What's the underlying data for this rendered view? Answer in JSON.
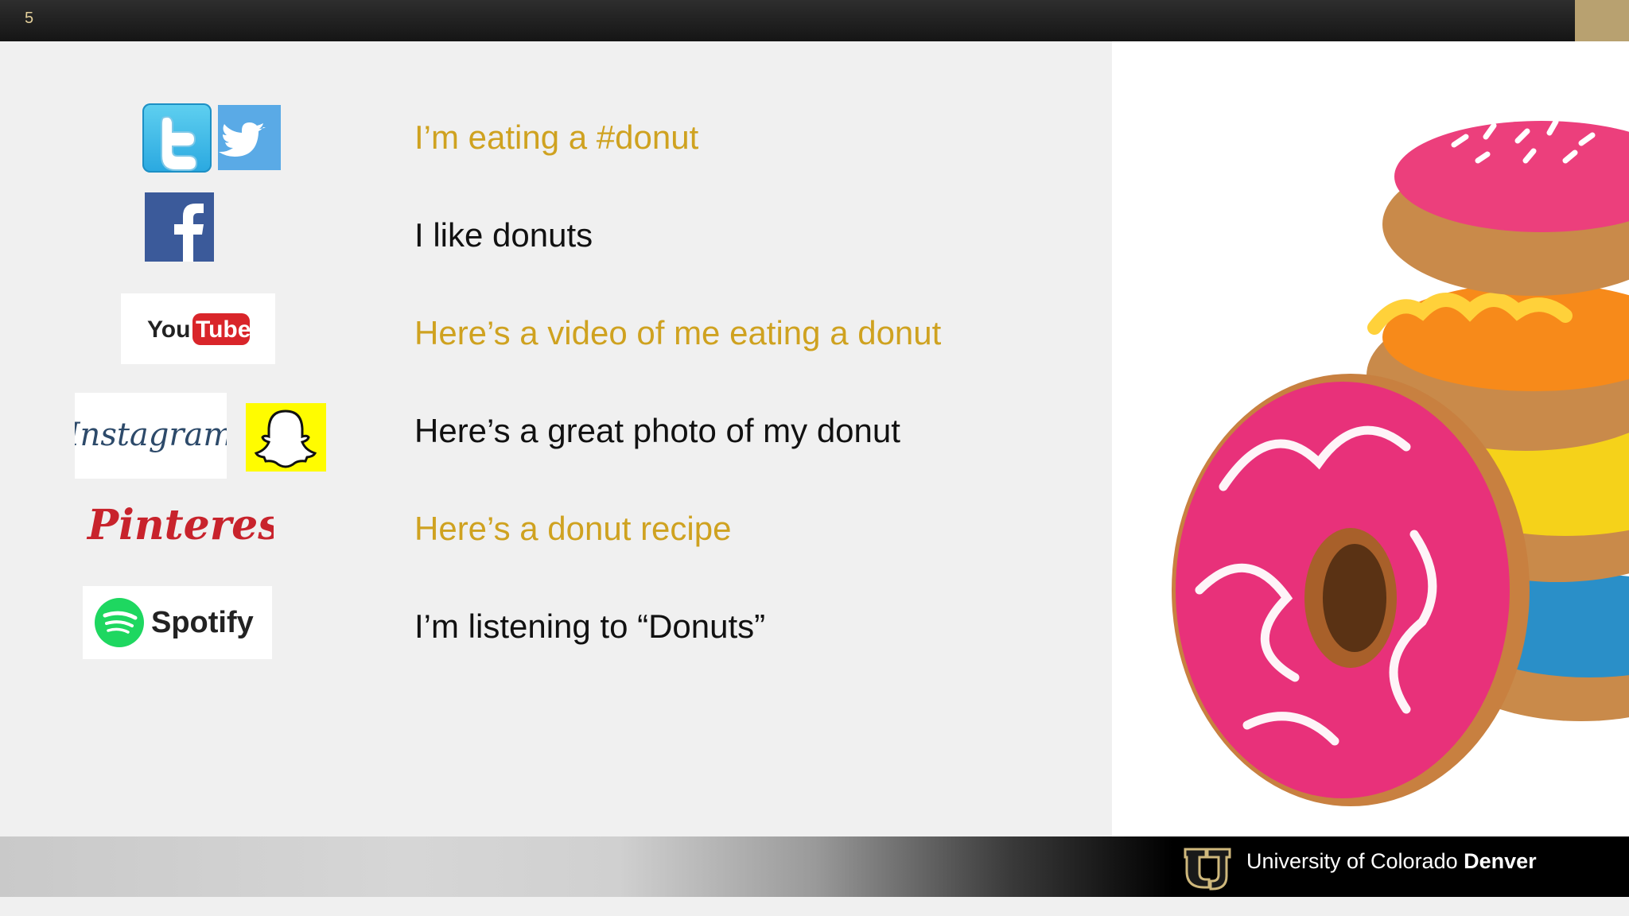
{
  "slide": {
    "number": "5"
  },
  "logos": [
    {
      "name": "twitter-bird-tile",
      "icon": "twitter-icon"
    },
    {
      "name": "twitter-bird-square",
      "icon": "twitter-icon"
    },
    {
      "name": "facebook",
      "icon": "facebook-icon"
    },
    {
      "name": "youtube",
      "icon": "youtube-logo",
      "text_you": "You",
      "text_tube": "Tube"
    },
    {
      "name": "instagram",
      "icon": "instagram-logo",
      "text": "Instagram"
    },
    {
      "name": "snapchat",
      "icon": "snapchat-ghost-icon"
    },
    {
      "name": "pinterest",
      "icon": "pinterest-logo",
      "text": "Pinterest"
    },
    {
      "name": "spotify",
      "icon": "spotify-logo",
      "text": "Spotify"
    }
  ],
  "lines": [
    {
      "text": "I’m eating a #donut",
      "color": "#cfa220"
    },
    {
      "text": "I like donuts",
      "color": "#111111"
    },
    {
      "text": "Here’s a video of me eating a donut",
      "color": "#cfa220"
    },
    {
      "text": "Here’s a great photo of my donut",
      "color": "#111111"
    },
    {
      "text": "Here’s a donut recipe",
      "color": "#cfa220"
    },
    {
      "text": "I’m listening to “Donuts”",
      "color": "#111111"
    }
  ],
  "photo": {
    "subject": "stacked frosted donuts"
  },
  "footer": {
    "brand_regular": "University of Colorado ",
    "brand_bold": "Denver",
    "logo": "cu-logo"
  },
  "colors": {
    "gold": "#cfa220",
    "cu_gold": "#b8a170",
    "top_bar": "#1e1e1e"
  }
}
